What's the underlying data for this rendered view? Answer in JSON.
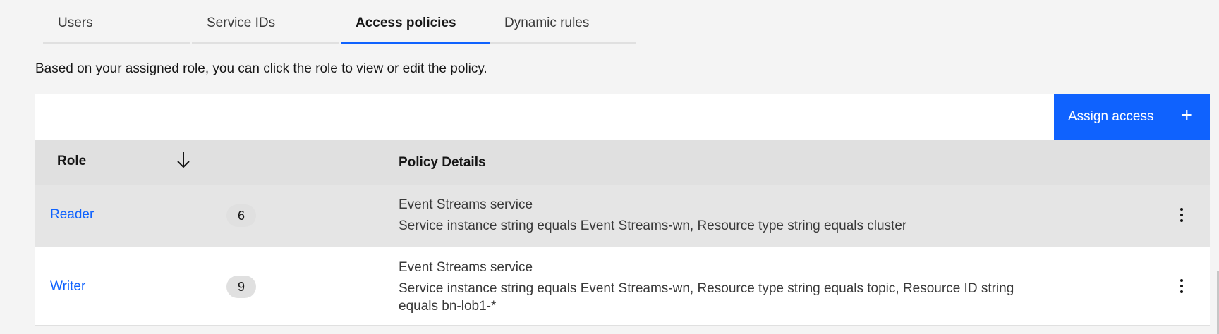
{
  "tabs": [
    {
      "label": "Users",
      "active": false
    },
    {
      "label": "Service IDs",
      "active": false
    },
    {
      "label": "Access policies",
      "active": true
    },
    {
      "label": "Dynamic rules",
      "active": false
    }
  ],
  "description": "Based on your assigned role, you can click the role to view or edit the policy.",
  "toolbar": {
    "assign_label": "Assign access",
    "assign_icon": "plus-icon"
  },
  "table": {
    "headers": {
      "role": "Role",
      "sort_icon": "arrow-down-icon",
      "policy": "Policy Details"
    },
    "rows": [
      {
        "role": "Reader",
        "count": "6",
        "policy_title": "Event Streams service",
        "policy_text": "Service instance string equals Event Streams-wn, Resource type string equals cluster"
      },
      {
        "role": "Writer",
        "count": "9",
        "policy_title": "Event Streams service",
        "policy_text": "Service instance string equals Event Streams-wn, Resource type string equals topic, Resource ID string equals bn-lob1-*"
      }
    ]
  },
  "colors": {
    "accent": "#0f62fe",
    "background": "#f4f4f4",
    "header_bg": "#e0e0e0"
  }
}
